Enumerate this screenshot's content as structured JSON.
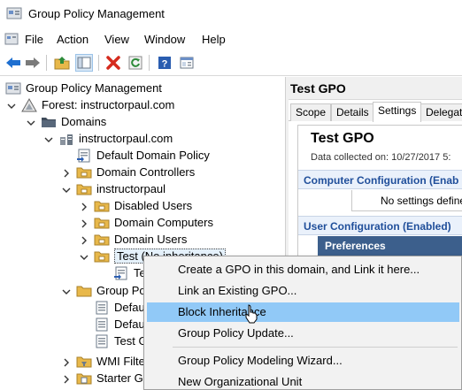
{
  "window": {
    "title": "Group Policy Management"
  },
  "menu": [
    "File",
    "Action",
    "View",
    "Window",
    "Help"
  ],
  "toolbar": {
    "icons": [
      "back-arrow-icon",
      "forward-arrow-icon",
      "up-folder-icon",
      "show-hide-tree-icon",
      "delete-icon",
      "refresh-icon",
      "help-icon",
      "properties-icon"
    ],
    "colors": {
      "back": "#1e6fd0",
      "forward": "#7a7a7a",
      "delete": "#d52b1e",
      "refresh": "#2e8b3a",
      "help": "#2a5db0"
    }
  },
  "tree": {
    "root": "Group Policy Management",
    "forest": "Forest: instructorpaul.com",
    "domains": "Domains",
    "domain": "instructorpaul.com",
    "default_domain_policy": "Default Domain Policy",
    "domain_controllers": "Domain Controllers",
    "ou_instructorpaul": "instructorpaul",
    "disabled_users": "Disabled Users",
    "domain_computers": "Domain Computers",
    "domain_users": "Domain Users",
    "test_ou": "Test (No inheritance)",
    "test_gpo_link": "Te",
    "group_policy_objects": "Group Po",
    "gpo_default_1": "Defau",
    "gpo_default_2": "Defau",
    "gpo_test": "Test G",
    "wmi_filters": "WMI Filte",
    "starter_gpos": "Starter GP"
  },
  "right": {
    "header": "Test GPO",
    "tabs": [
      "Scope",
      "Details",
      "Settings",
      "Delegati"
    ],
    "active_tab": "Settings",
    "report_title": "Test GPO",
    "collected": "Data collected on: 10/27/2017 5:",
    "computer_config": "Computer Configuration (Enab",
    "no_settings": "No settings defined.",
    "user_config": "User Configuration (Enabled)",
    "preferences": "Preferences"
  },
  "context_menu": {
    "items": [
      "Create a GPO in this domain, and Link it here...",
      "Link an Existing GPO...",
      "Block Inheritance",
      "Group Policy Update...",
      "Group Policy Modeling Wizard...",
      "New Organizational Unit"
    ],
    "highlighted": "Block Inheritance",
    "highlight_color": "#91c9f7"
  }
}
